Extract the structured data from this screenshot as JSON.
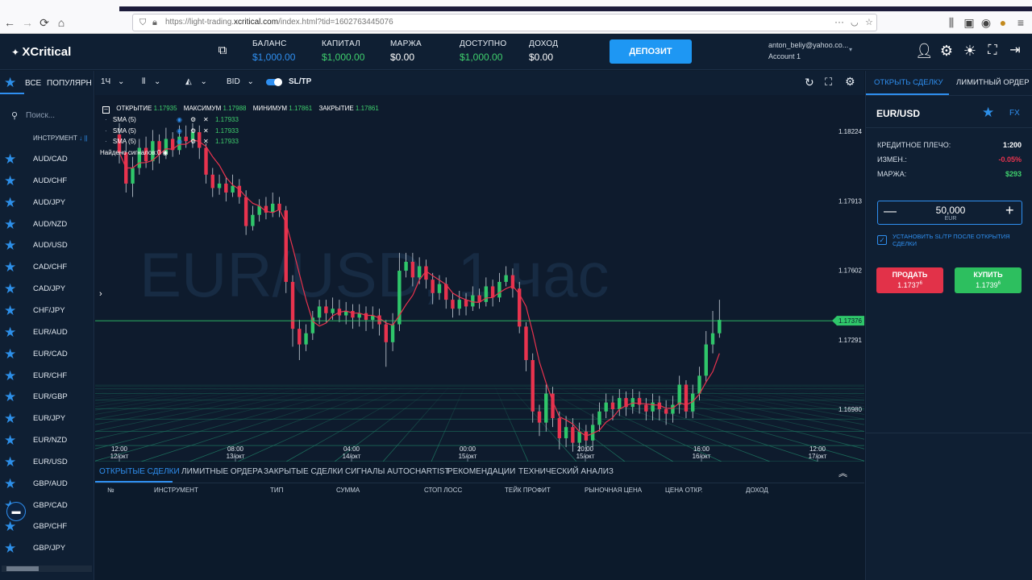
{
  "browser": {
    "url_prefix": "https://light-trading.",
    "url_domain": "xcritical.com",
    "url_suffix": "/index.html?tid=1602763445076"
  },
  "header": {
    "logo": "XCritical",
    "stats": [
      {
        "label": "БАЛАНС",
        "value": "$1,000.00",
        "color": "#2f8ff0"
      },
      {
        "label": "КАПИТАЛ",
        "value": "$1,000.00",
        "color": "#3fcf6d"
      },
      {
        "label": "МАРЖА",
        "value": "$0.00",
        "color": "#ffffff"
      },
      {
        "label": "ДОСТУПНО",
        "value": "$1,000.00",
        "color": "#3fcf6d"
      },
      {
        "label": "ДОХОД",
        "value": "$0.00",
        "color": "#ffffff"
      }
    ],
    "deposit_label": "ДЕПОЗИТ",
    "email": "anton_beliy@yahoo.co...",
    "account": "Account 1"
  },
  "sidebar": {
    "tab_all": "ВСЕ",
    "tab_popular": "ПОПУЛЯРНЫ",
    "search_placeholder": "Поиск...",
    "column_header": "ИНСТРУМЕНТ",
    "instruments": [
      "AUD/CAD",
      "AUD/CHF",
      "AUD/JPY",
      "AUD/NZD",
      "AUD/USD",
      "CAD/CHF",
      "CAD/JPY",
      "CHF/JPY",
      "EUR/AUD",
      "EUR/CAD",
      "EUR/CHF",
      "EUR/GBP",
      "EUR/JPY",
      "EUR/NZD",
      "EUR/USD",
      "GBP/AUD",
      "GBP/CAD",
      "GBP/CHF",
      "GBP/JPY"
    ]
  },
  "toolbar": {
    "timeframe": "1Ч",
    "price_type": "BID",
    "sltp": "SL/TP"
  },
  "chart_legend": {
    "open_label": "ОТКРЫТИЕ",
    "open": "1.17935",
    "high_label": "МАКСИМУМ",
    "high": "1.17988",
    "low_label": "МИНИМУМ",
    "low": "1.17861",
    "close_label": "ЗАКРЫТИЕ",
    "close": "1.17861",
    "indicators": [
      {
        "name": "SMA (5)",
        "value": "1.17933"
      },
      {
        "name": "SMA (5)",
        "value": "1.17933"
      },
      {
        "name": "SMA (5)",
        "value": "1.17933"
      }
    ],
    "signals": "Найдено сигналов:0",
    "watermark": "EUR/USD, 1 час"
  },
  "chart_data": {
    "type": "candlestick",
    "y_ticks": [
      "1.18224",
      "1.17913",
      "1.17602",
      "1.17291",
      "1.16980"
    ],
    "y_tick_values": [
      1.18224,
      1.17913,
      1.17602,
      1.17291,
      1.1698
    ],
    "current_price": "1.17376",
    "current_price_value": 1.17376,
    "x_ticks": [
      {
        "time": "12:00",
        "date": "12/окт"
      },
      {
        "time": "08:00",
        "date": "13/окт"
      },
      {
        "time": "04:00",
        "date": "14/окт"
      },
      {
        "time": "00:00",
        "date": "15/окт"
      },
      {
        "time": "20:00",
        "date": "15/окт"
      },
      {
        "time": "16:00",
        "date": "16/окт"
      },
      {
        "time": "12:00",
        "date": "17/окт"
      }
    ],
    "up_color": "#2fc66a",
    "down_color": "#e8334e",
    "sma_color": "#e8334e",
    "candles": [
      [
        1.1821,
        1.1813,
        1.1826,
        1.1808
      ],
      [
        1.1813,
        1.1799,
        1.1817,
        1.1795
      ],
      [
        1.1799,
        1.1806,
        1.1811,
        1.1793
      ],
      [
        1.1806,
        1.1815,
        1.1819,
        1.1803
      ],
      [
        1.1815,
        1.1809,
        1.182,
        1.1806
      ],
      [
        1.1809,
        1.1818,
        1.1823,
        1.1805
      ],
      [
        1.1818,
        1.1812,
        1.1821,
        1.1808
      ],
      [
        1.1812,
        1.1819,
        1.1824,
        1.181
      ],
      [
        1.1819,
        1.1814,
        1.1822,
        1.1811
      ],
      [
        1.1814,
        1.182,
        1.1825,
        1.1812
      ],
      [
        1.182,
        1.1818,
        1.1825,
        1.1815
      ],
      [
        1.1818,
        1.1822,
        1.1826,
        1.1815
      ],
      [
        1.1822,
        1.1815,
        1.1825,
        1.181
      ],
      [
        1.1815,
        1.1803,
        1.1817,
        1.1799
      ],
      [
        1.1803,
        1.1797,
        1.1806,
        1.1793
      ],
      [
        1.1797,
        1.1799,
        1.1803,
        1.1794
      ],
      [
        1.1799,
        1.1795,
        1.1802,
        1.1791
      ],
      [
        1.1795,
        1.1798,
        1.1803,
        1.1793
      ],
      [
        1.1798,
        1.1793,
        1.1801,
        1.179
      ],
      [
        1.1793,
        1.178,
        1.1796,
        1.1776
      ],
      [
        1.178,
        1.1785,
        1.1789,
        1.1778
      ],
      [
        1.1785,
        1.1789,
        1.1792,
        1.1782
      ],
      [
        1.1789,
        1.1786,
        1.1793,
        1.1783
      ],
      [
        1.1786,
        1.179,
        1.1795,
        1.1784
      ],
      [
        1.179,
        1.1787,
        1.1793,
        1.1784
      ],
      [
        1.1787,
        1.1755,
        1.1789,
        1.175
      ],
      [
        1.1755,
        1.1734,
        1.1758,
        1.1726
      ],
      [
        1.1734,
        1.1727,
        1.1738,
        1.172
      ],
      [
        1.1727,
        1.1732,
        1.1736,
        1.1724
      ],
      [
        1.1732,
        1.1739,
        1.1742,
        1.1729
      ],
      [
        1.1739,
        1.1744,
        1.1747,
        1.1736
      ],
      [
        1.1744,
        1.1741,
        1.1747,
        1.1737
      ],
      [
        1.1741,
        1.1743,
        1.1748,
        1.1738
      ],
      [
        1.1743,
        1.174,
        1.1747,
        1.1737
      ],
      [
        1.174,
        1.1742,
        1.1746,
        1.1736
      ],
      [
        1.1742,
        1.1739,
        1.1745,
        1.1734
      ],
      [
        1.1739,
        1.1741,
        1.1745,
        1.1735
      ],
      [
        1.1741,
        1.1738,
        1.1744,
        1.1733
      ],
      [
        1.1738,
        1.174,
        1.1744,
        1.1734
      ],
      [
        1.174,
        1.1736,
        1.1743,
        1.1731
      ],
      [
        1.1736,
        1.1728,
        1.1738,
        1.1717
      ],
      [
        1.1728,
        1.1736,
        1.1741,
        1.1724
      ],
      [
        1.1736,
        1.176,
        1.1768,
        1.1733
      ],
      [
        1.176,
        1.1764,
        1.1768,
        1.1757
      ],
      [
        1.1764,
        1.1757,
        1.1768,
        1.1753
      ],
      [
        1.1757,
        1.1762,
        1.1766,
        1.1754
      ],
      [
        1.1762,
        1.1756,
        1.1765,
        1.1752
      ],
      [
        1.1756,
        1.175,
        1.1759,
        1.1745
      ],
      [
        1.175,
        1.1754,
        1.1758,
        1.1747
      ],
      [
        1.1754,
        1.1747,
        1.1757,
        1.1743
      ],
      [
        1.1747,
        1.1743,
        1.175,
        1.1739
      ],
      [
        1.1743,
        1.1747,
        1.1751,
        1.174
      ],
      [
        1.1747,
        1.1744,
        1.175,
        1.174
      ],
      [
        1.1744,
        1.1749,
        1.1753,
        1.1742
      ],
      [
        1.1749,
        1.1746,
        1.1752,
        1.1743
      ],
      [
        1.1746,
        1.1753,
        1.1757,
        1.1744
      ],
      [
        1.1753,
        1.1748,
        1.1756,
        1.1744
      ],
      [
        1.1748,
        1.1755,
        1.1759,
        1.1746
      ],
      [
        1.1755,
        1.1758,
        1.1762,
        1.1753
      ],
      [
        1.1758,
        1.1752,
        1.1761,
        1.1748
      ],
      [
        1.1752,
        1.1735,
        1.1755,
        1.1732
      ],
      [
        1.1735,
        1.172,
        1.1737,
        1.1715
      ],
      [
        1.172,
        1.1697,
        1.1723,
        1.1692
      ],
      [
        1.1697,
        1.1692,
        1.17,
        1.1686
      ],
      [
        1.1692,
        1.1705,
        1.1709,
        1.1688
      ],
      [
        1.1705,
        1.1694,
        1.1708,
        1.169
      ],
      [
        1.1694,
        1.1685,
        1.1697,
        1.168
      ],
      [
        1.1685,
        1.169,
        1.1695,
        1.1681
      ],
      [
        1.169,
        1.1683,
        1.1694,
        1.1679
      ],
      [
        1.1683,
        1.1688,
        1.1692,
        1.1679
      ],
      [
        1.1688,
        1.1684,
        1.1691,
        1.1679
      ],
      [
        1.1684,
        1.1691,
        1.1696,
        1.1681
      ],
      [
        1.1691,
        1.1697,
        1.1701,
        1.1688
      ],
      [
        1.1697,
        1.1701,
        1.1705,
        1.1694
      ],
      [
        1.1701,
        1.1698,
        1.1704,
        1.1693
      ],
      [
        1.1698,
        1.1703,
        1.1707,
        1.1695
      ],
      [
        1.1703,
        1.1699,
        1.1706,
        1.1695
      ],
      [
        1.1699,
        1.1703,
        1.1707,
        1.1696
      ],
      [
        1.1703,
        1.17,
        1.1706,
        1.1696
      ],
      [
        1.17,
        1.1697,
        1.1703,
        1.1693
      ],
      [
        1.1697,
        1.1701,
        1.1705,
        1.1693
      ],
      [
        1.1701,
        1.1698,
        1.1704,
        1.1693
      ],
      [
        1.1698,
        1.1696,
        1.1702,
        1.1691
      ],
      [
        1.1696,
        1.17,
        1.1704,
        1.1692
      ],
      [
        1.17,
        1.1709,
        1.1713,
        1.1696
      ],
      [
        1.1709,
        1.1697,
        1.1711,
        1.1694
      ],
      [
        1.1697,
        1.1705,
        1.1709,
        1.1694
      ],
      [
        1.1705,
        1.1713,
        1.1717,
        1.1702
      ],
      [
        1.1713,
        1.1727,
        1.1733,
        1.171
      ],
      [
        1.1727,
        1.1732,
        1.1742,
        1.1723
      ],
      [
        1.1732,
        1.1738,
        1.1747,
        1.173
      ]
    ]
  },
  "bottom": {
    "tabs": [
      "ОТКРЫТЫЕ СДЕЛКИ",
      "ЛИМИТНЫЕ ОРДЕРА",
      "ЗАКРЫТЫЕ СДЕЛКИ",
      "СИГНАЛЫ AUTOCHARTIST",
      "РЕКОМЕНДАЦИИ",
      "ТЕХНИЧЕСКИЙ АНАЛИЗ"
    ],
    "columns": [
      "№",
      "ИНСТРУМЕНТ",
      "ТИП",
      "СУММА",
      "СТОП ЛОСС",
      "ТЕЙК ПРОФИТ",
      "РЫНОЧНАЯ ЦЕНА",
      "ЦЕНА ОТКР.",
      "ДОХОД"
    ]
  },
  "right_panel": {
    "tab_open": "ОТКРЫТЬ СДЕЛКУ",
    "tab_limit": "ЛИМИТНЫЙ ОРДЕР",
    "symbol": "EUR/USD",
    "market": "FX",
    "leverage_label": "КРЕДИТНОЕ ПЛЕЧО:",
    "leverage": "1:200",
    "change_label": "ИЗМЕН.:",
    "change": "-0.05%",
    "margin_label": "МАРЖА:",
    "margin": "$293",
    "amount": "50,000",
    "currency": "EUR",
    "sltp_check": "УСТАНОВИТЬ SL/TP ПОСЛЕ ОТКРЫТИЯ СДЕЛКИ",
    "sell_label": "ПРОДАТЬ",
    "sell_price_main": "1.1737",
    "sell_price_sup": "6",
    "buy_label": "КУПИТЬ",
    "buy_price_main": "1.1739",
    "buy_price_sup": "6"
  }
}
